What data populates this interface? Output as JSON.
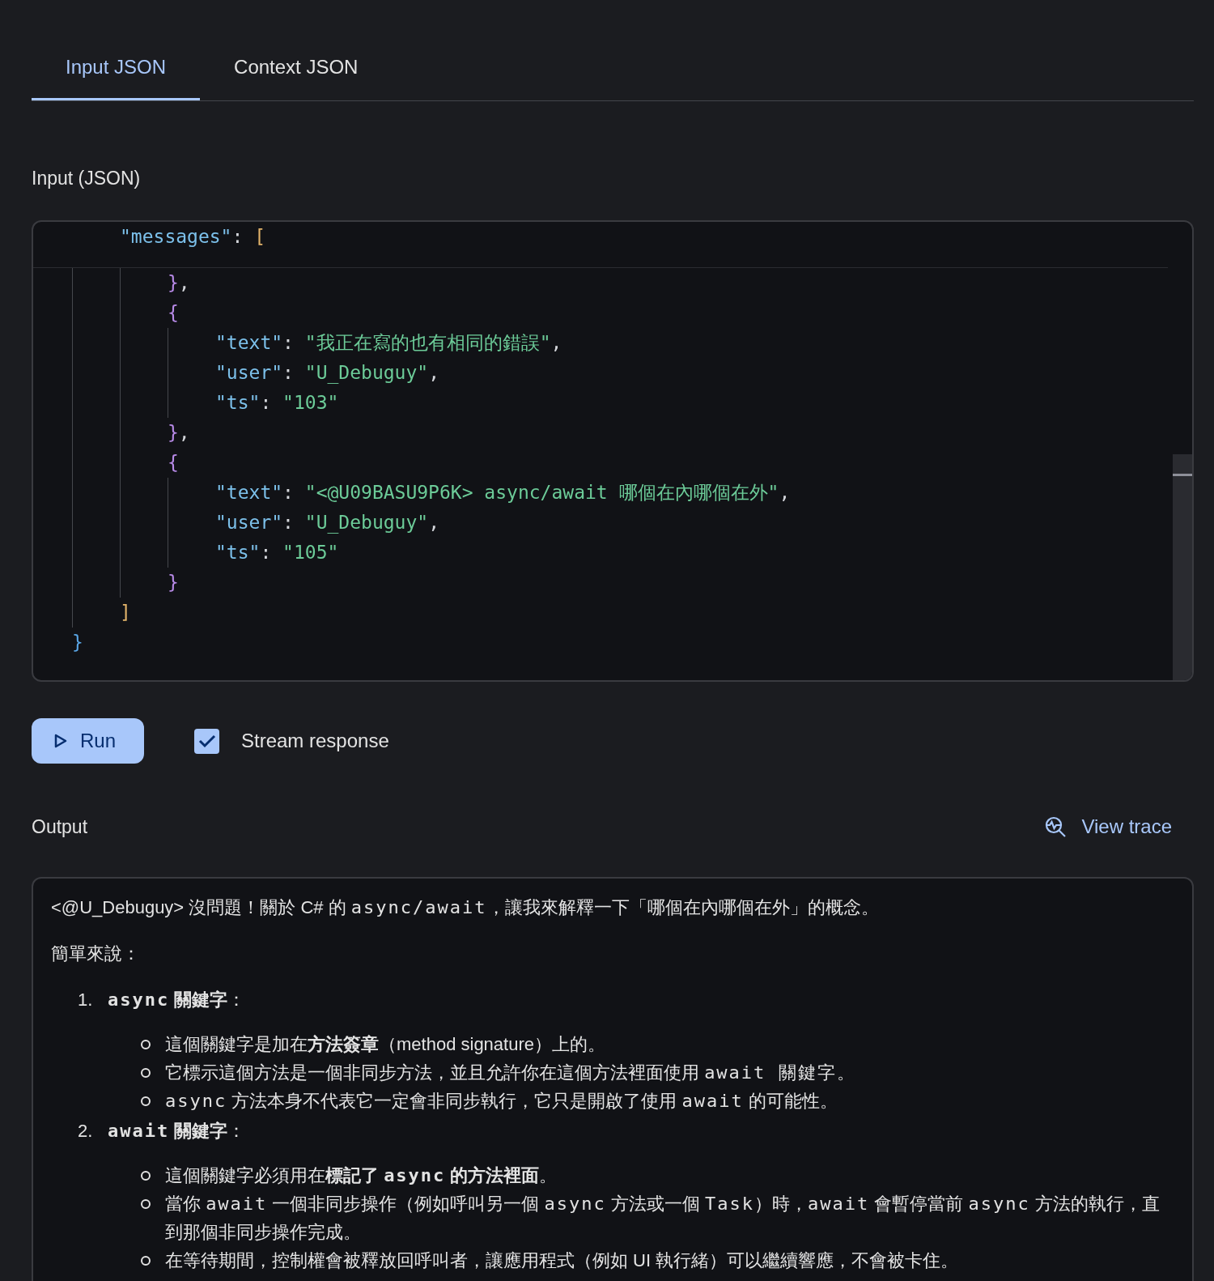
{
  "tabs": [
    {
      "label": "Input JSON",
      "selected": true
    },
    {
      "label": "Context JSON",
      "selected": false
    }
  ],
  "input_label": "Input (JSON)",
  "code": {
    "children": [
      {
        "open": [
          {
            "kind": "key",
            "text": "\"messages\""
          },
          {
            "kind": "punct",
            "text": ": "
          },
          {
            "kind": "bracket_gold",
            "text": "["
          }
        ],
        "children": [
          {
            "close": [
              {
                "kind": "bracket_purple",
                "text": "}"
              },
              {
                "kind": "punct",
                "text": ","
              }
            ]
          },
          {
            "open": [
              {
                "kind": "bracket_purple",
                "text": "{"
              }
            ],
            "children": [
              {
                "tokens": [
                  {
                    "kind": "key",
                    "text": "\"text\""
                  },
                  {
                    "kind": "punct",
                    "text": ": "
                  },
                  {
                    "kind": "string",
                    "text": "\"我正在寫的也有相同的錯誤\""
                  },
                  {
                    "kind": "punct",
                    "text": ","
                  }
                ]
              },
              {
                "tokens": [
                  {
                    "kind": "key",
                    "text": "\"user\""
                  },
                  {
                    "kind": "punct",
                    "text": ": "
                  },
                  {
                    "kind": "string",
                    "text": "\"U_Debuguy\""
                  },
                  {
                    "kind": "punct",
                    "text": ","
                  }
                ]
              },
              {
                "tokens": [
                  {
                    "kind": "key",
                    "text": "\"ts\""
                  },
                  {
                    "kind": "punct",
                    "text": ": "
                  },
                  {
                    "kind": "string",
                    "text": "\"103\""
                  }
                ]
              }
            ],
            "close": [
              {
                "kind": "bracket_purple",
                "text": "}"
              },
              {
                "kind": "punct",
                "text": ","
              }
            ]
          },
          {
            "open": [
              {
                "kind": "bracket_purple",
                "text": "{"
              }
            ],
            "children": [
              {
                "tokens": [
                  {
                    "kind": "key",
                    "text": "\"text\""
                  },
                  {
                    "kind": "punct",
                    "text": ": "
                  },
                  {
                    "kind": "string",
                    "text": "\"<@U09BASU9P6K> async/await 哪個在內哪個在外\""
                  },
                  {
                    "kind": "punct",
                    "text": ","
                  }
                ]
              },
              {
                "tokens": [
                  {
                    "kind": "key",
                    "text": "\"user\""
                  },
                  {
                    "kind": "punct",
                    "text": ": "
                  },
                  {
                    "kind": "string",
                    "text": "\"U_Debuguy\""
                  },
                  {
                    "kind": "punct",
                    "text": ","
                  }
                ]
              },
              {
                "tokens": [
                  {
                    "kind": "key",
                    "text": "\"ts\""
                  },
                  {
                    "kind": "punct",
                    "text": ": "
                  },
                  {
                    "kind": "string",
                    "text": "\"105\""
                  }
                ]
              }
            ],
            "close": [
              {
                "kind": "bracket_purple",
                "text": "}"
              }
            ]
          }
        ],
        "close": [
          {
            "kind": "bracket_gold",
            "text": "]"
          }
        ]
      }
    ],
    "close": [
      {
        "kind": "bracket_blue",
        "text": "}"
      }
    ]
  },
  "run_button": "Run",
  "stream_response": {
    "label": "Stream response",
    "checked": true
  },
  "output_label": "Output",
  "view_trace": "View trace",
  "output": [
    {
      "kind": "paragraph",
      "segments": [
        {
          "kind": "text",
          "text": "<@U_Debuguy> 沒問題！關於 C# 的 "
        },
        {
          "kind": "code",
          "text": "async/await"
        },
        {
          "kind": "text",
          "text": "，讓我來解釋一下「哪個在內哪個在外」的概念。"
        }
      ]
    },
    {
      "kind": "paragraph",
      "segments": [
        {
          "kind": "text",
          "text": "簡單來說："
        }
      ]
    },
    {
      "kind": "ordered_list",
      "items": [
        {
          "number": "1.",
          "segments": [
            {
              "kind": "code",
              "text": "**async**"
            },
            {
              "kind": "text",
              "text": " **關鍵字**："
            }
          ],
          "children": [
            {
              "segments": [
                {
                  "kind": "text",
                  "text": "這個關鍵字是加在**方法簽章**（method signature）上的。"
                }
              ]
            },
            {
              "segments": [
                {
                  "kind": "text",
                  "text": "它標示這個方法是一個非同步方法，並且允許你在這個方法裡面使用 "
                },
                {
                  "kind": "code",
                  "text": "await 關鍵字。"
                }
              ]
            },
            {
              "segments": [
                {
                  "kind": "code",
                  "text": "async"
                },
                {
                  "kind": "text",
                  "text": " 方法本身不代表它一定會非同步執行，它只是開啟了使用 "
                },
                {
                  "kind": "code",
                  "text": "await"
                },
                {
                  "kind": "text",
                  "text": " 的可能性。"
                }
              ]
            }
          ]
        },
        {
          "number": "2.",
          "segments": [
            {
              "kind": "code",
              "text": "**await**"
            },
            {
              "kind": "text",
              "text": " **關鍵字**："
            }
          ],
          "children": [
            {
              "segments": [
                {
                  "kind": "text",
                  "text": "這個關鍵字必須用在**標記了** "
                },
                {
                  "kind": "code",
                  "text": "**async**"
                },
                {
                  "kind": "text",
                  "text": " **的方法裡面**。"
                }
              ]
            },
            {
              "segments": [
                {
                  "kind": "text",
                  "text": "當你 "
                },
                {
                  "kind": "code",
                  "text": "await"
                },
                {
                  "kind": "text",
                  "text": " 一個非同步操作（例如呼叫另一個 "
                },
                {
                  "kind": "code",
                  "text": "async"
                },
                {
                  "kind": "text",
                  "text": " 方法或一個 "
                },
                {
                  "kind": "code",
                  "text": "Task"
                },
                {
                  "kind": "text",
                  "text": "）時，"
                },
                {
                  "kind": "code",
                  "text": "await"
                },
                {
                  "kind": "text",
                  "text": " 會暫停當前 "
                },
                {
                  "kind": "code",
                  "text": "async"
                },
                {
                  "kind": "text",
                  "text": " 方法的執行，直到那個非同步操作完成。"
                }
              ]
            },
            {
              "segments": [
                {
                  "kind": "text",
                  "text": "在等待期間，控制權會被釋放回呼叫者，讓應用程式（例如 UI 執行緒）可以繼續響應，不會被卡住。"
                }
              ]
            }
          ]
        }
      ]
    }
  ]
}
